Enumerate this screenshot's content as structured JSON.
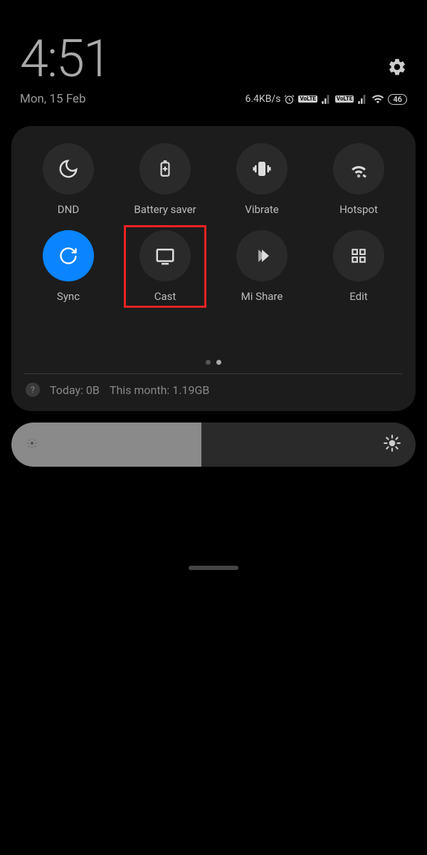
{
  "status": {
    "time": "4:51",
    "date": "Mon, 15 Feb",
    "network_speed": "6.4KB/s",
    "battery_level": "46",
    "lte_badge": "VoLTE"
  },
  "tiles": [
    {
      "label": "DND",
      "icon": "moon",
      "active": false
    },
    {
      "label": "Battery saver",
      "icon": "battery-plus",
      "active": false
    },
    {
      "label": "Vibrate",
      "icon": "vibrate",
      "active": false
    },
    {
      "label": "Hotspot",
      "icon": "hotspot",
      "active": false
    },
    {
      "label": "Sync",
      "icon": "sync",
      "active": true
    },
    {
      "label": "Cast",
      "icon": "cast",
      "active": false,
      "highlighted": true
    },
    {
      "label": "Mi Share",
      "icon": "share",
      "active": false
    },
    {
      "label": "Edit",
      "icon": "grid",
      "active": false
    }
  ],
  "data_usage": {
    "today": "Today: 0B",
    "month": "This month: 1.19GB"
  },
  "brightness": {
    "level_percent": 47
  }
}
